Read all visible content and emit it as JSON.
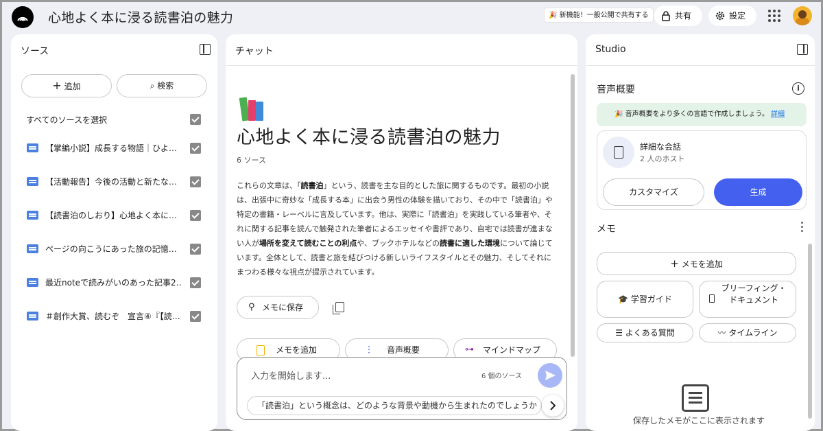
{
  "app": {
    "notebook_title": "心地よく本に浸る読書泊の魅力",
    "promo": "🎉 新機能！一般公開で共有する",
    "share_label": "共有",
    "settings_label": "設定"
  },
  "sources": {
    "title": "ソース",
    "add_label": "追加",
    "search_label": "検索",
    "select_all_label": "すべてのソースを選択",
    "items": [
      {
        "label": "【掌編小説】成長する物語｜ひよ…"
      },
      {
        "label": "【活動報告】今後の活動と新たな…"
      },
      {
        "label": "【読書泊のしおり】心地よく本に…"
      },
      {
        "label": "ページの向こうにあった旅の記憶…"
      },
      {
        "label": "最近noteで読みがいのあった記事2…"
      },
      {
        "label": "＃創作大賞、読むぞ　宣言④『【読…"
      }
    ]
  },
  "chat": {
    "title": "チャット",
    "notebook_title": "心地よく本に浸る読書泊の魅力",
    "source_count": "6 ソース",
    "summary_parts": [
      "これらの文章は、「",
      "読書泊",
      "」という、読書を主な目的とした旅に関するものです。最初の小説は、出張中に奇妙な「成長する本」に出会う男性の体験を描いており、その中で「読書泊」や特定の書籍・レーベルに言及しています。他は、実際に「読書泊」を実践している筆者や、それに関する記事を読んで触発された筆者によるエッセイや書評であり、自宅では読書が進まない人が",
      "場所を変えて読むことの利点",
      "や、ブックホテルなどの",
      "読書に適した環境",
      "について論じています。全体として、読書と旅を結びつける新しいライフスタイルとその魅力、そしてそれにまつわる様々な視点が提示されています。"
    ],
    "save_memo_label": "メモに保存",
    "chips": [
      "メモを追加",
      "音声概要",
      "マインドマップ"
    ],
    "input_placeholder": "入力を開始します...",
    "input_source_count": "6 個のソース",
    "suggestion": "「読書泊」という概念は、どのような背景や動機から生まれたのでしょうか"
  },
  "studio": {
    "title": "Studio",
    "audio_title": "音声概要",
    "banner_text": "🎉 音声概要をより多くの言語で作成しましょう。",
    "banner_link": "詳細",
    "card_title": "詳細な会話",
    "card_subtitle": "2 人のホスト",
    "customize_label": "カスタマイズ",
    "generate_label": "生成",
    "memo_title": "メモ",
    "add_memo_label": "メモを追加",
    "study_guide_label": "学習ガイド",
    "briefing_label": "ブリーフィング・ドキュメント",
    "faq_label": "よくある質問",
    "timeline_label": "タイムライン",
    "empty_text": "保存したメモがここに表示されます"
  },
  "colors": {
    "accent": "#4361ee",
    "banner_bg": "#e4f3e8",
    "doc_icon": "#4a80e0"
  }
}
